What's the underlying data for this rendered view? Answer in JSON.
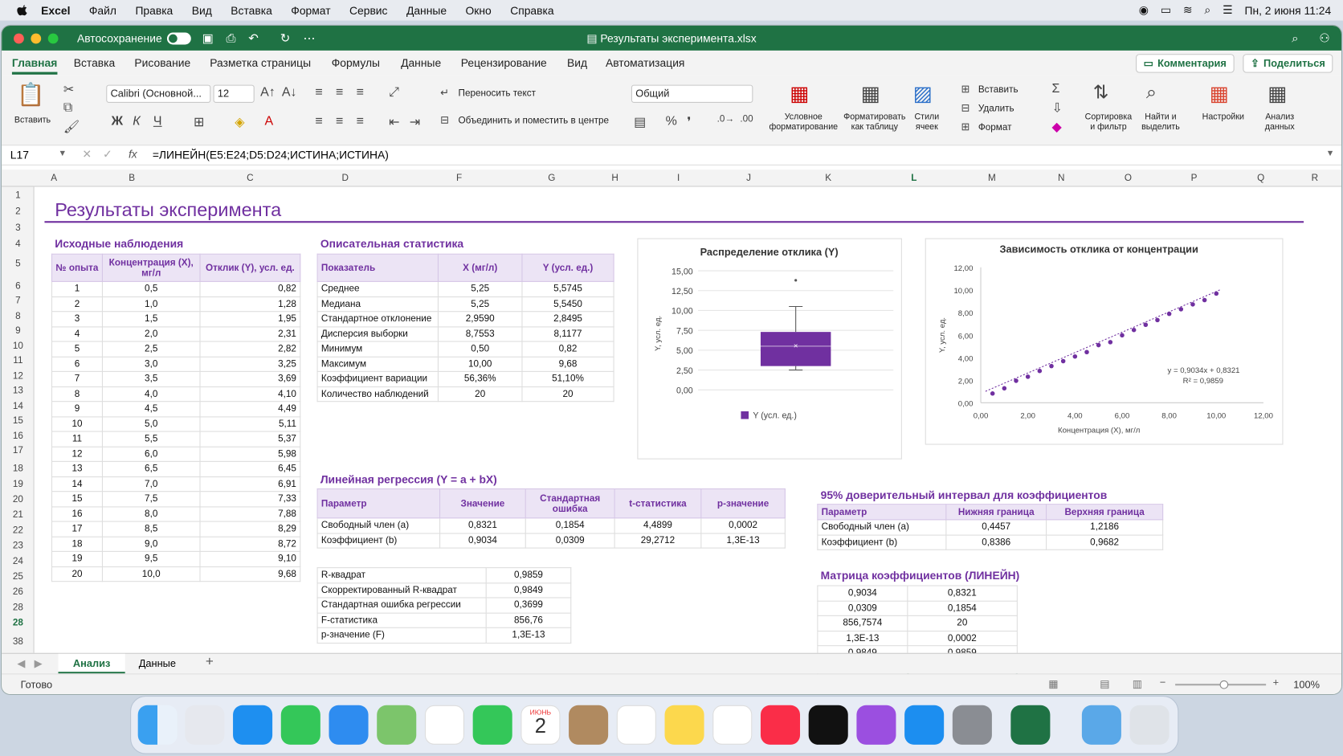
{
  "menubar": {
    "app": "Excel",
    "items": [
      "Файл",
      "Правка",
      "Вид",
      "Вставка",
      "Формат",
      "Сервис",
      "Данные",
      "Окно",
      "Справка"
    ],
    "clock": "Пн, 2 июня  11:24"
  },
  "titlebar": {
    "autosave": "Автосохранение",
    "filename": "Результаты эксперимента.xlsx"
  },
  "ribbon_tabs": [
    "Главная",
    "Вставка",
    "Рисование",
    "Разметка страницы",
    "Формулы",
    "Данные",
    "Рецензирование",
    "Вид",
    "Автоматизация"
  ],
  "comments_button": "Комментария",
  "share_button": "Поделиться",
  "ribbon": {
    "paste": "Вставить",
    "font": "Calibri (Основной...",
    "size": "12",
    "wrap": "Переносить текст",
    "merge": "Объединить и поместить в центре",
    "numfmt": "Общий",
    "cond1": "Условное",
    "cond2": "форматирование",
    "fmt1": "Форматировать",
    "fmt2": "как таблицу",
    "styles1": "Стили",
    "styles2": "ячеек",
    "insert": "Вставить",
    "delete": "Удалить",
    "format": "Формат",
    "sort1": "Сортировка",
    "sort2": "и фильтр",
    "find1": "Найти и",
    "find2": "выделить",
    "settings": "Настройки",
    "analysis1": "Анализ",
    "analysis2": "данных",
    "bold": "Ж",
    "italic": "К",
    "underline": "Ч"
  },
  "formula_bar": {
    "cell": "L17",
    "formula": "=ЛИНЕЙН(E5:E24;D5:D24;ИСТИНА;ИСТИНА)"
  },
  "columns": [
    [
      "A",
      61
    ],
    [
      "B",
      152
    ],
    [
      "C",
      290
    ],
    [
      "D",
      401
    ],
    [
      "F",
      534
    ],
    [
      "G",
      642
    ],
    [
      "H",
      716
    ],
    [
      "I",
      790
    ],
    [
      "J",
      872
    ],
    [
      "K",
      965
    ],
    [
      "L",
      1065
    ],
    [
      "M",
      1156
    ],
    [
      "N",
      1237
    ],
    [
      "O",
      1315
    ],
    [
      "P",
      1392
    ],
    [
      "Q",
      1470
    ],
    [
      "R",
      1533
    ]
  ],
  "rows": [
    "1",
    "2",
    "3",
    "4",
    "5",
    "6",
    "7",
    "8",
    "9",
    "10",
    "11",
    "12",
    "13",
    "14",
    "15",
    "16",
    "17",
    "18",
    "19",
    "20",
    "21",
    "22",
    "23",
    "24",
    "25",
    "26",
    "28",
    "28",
    "38"
  ],
  "sheet": {
    "title": "Результаты эксперимента",
    "obs": {
      "title": "Исходные наблюдения",
      "headers": [
        "№ опыта",
        "Концентрация (X), мг/л",
        "Отклик (Y), усл. ед."
      ],
      "rows": [
        [
          "1",
          "0,5",
          "0,82"
        ],
        [
          "2",
          "1,0",
          "1,28"
        ],
        [
          "3",
          "1,5",
          "1,95"
        ],
        [
          "4",
          "2,0",
          "2,31"
        ],
        [
          "5",
          "2,5",
          "2,82"
        ],
        [
          "6",
          "3,0",
          "3,25"
        ],
        [
          "7",
          "3,5",
          "3,69"
        ],
        [
          "8",
          "4,0",
          "4,10"
        ],
        [
          "9",
          "4,5",
          "4,49"
        ],
        [
          "10",
          "5,0",
          "5,11"
        ],
        [
          "11",
          "5,5",
          "5,37"
        ],
        [
          "12",
          "6,0",
          "5,98"
        ],
        [
          "13",
          "6,5",
          "6,45"
        ],
        [
          "14",
          "7,0",
          "6,91"
        ],
        [
          "15",
          "7,5",
          "7,33"
        ],
        [
          "16",
          "8,0",
          "7,88"
        ],
        [
          "17",
          "8,5",
          "8,29"
        ],
        [
          "18",
          "9,0",
          "8,72"
        ],
        [
          "19",
          "9,5",
          "9,10"
        ],
        [
          "20",
          "10,0",
          "9,68"
        ]
      ]
    },
    "desc": {
      "title": "Описательная статистика",
      "headers": [
        "Показатель",
        "X (мг/л)",
        "Y (усл. ед.)"
      ],
      "rows": [
        [
          "Среднее",
          "5,25",
          "5,5745"
        ],
        [
          "Медиана",
          "5,25",
          "5,5450"
        ],
        [
          "Стандартное отклонение",
          "2,9590",
          "2,8495"
        ],
        [
          "Дисперсия выборки",
          "8,7553",
          "8,1177"
        ],
        [
          "Минимум",
          "0,50",
          "0,82"
        ],
        [
          "Максимум",
          "10,00",
          "9,68"
        ],
        [
          "Коэффициент вариации",
          "56,36%",
          "51,10%"
        ],
        [
          "Количество наблюдений",
          "20",
          "20"
        ]
      ]
    },
    "reg": {
      "title": "Линейная регрессия (Y = a + bX)",
      "headers": [
        "Параметр",
        "Значение",
        "Стандартная ошибка",
        "t-статистика",
        "p-значение"
      ],
      "rows": [
        [
          "Свободный член (a)",
          "0,8321",
          "0,1854",
          "4,4899",
          "0,0002"
        ],
        [
          "Коэффициент (b)",
          "0,9034",
          "0,0309",
          "29,2712",
          "1,3E-13"
        ]
      ]
    },
    "fit": {
      "rows": [
        [
          "R-квадрат",
          "0,9859"
        ],
        [
          "Скорректированный R-квадрат",
          "0,9849"
        ],
        [
          "Стандартная ошибка регрессии",
          "0,3699"
        ],
        [
          "F-статистика",
          "856,76"
        ],
        [
          "p-значение (F)",
          "1,3E-13"
        ]
      ]
    },
    "ci": {
      "title": "95% доверительный интервал для коэффициентов",
      "headers": [
        "Параметр",
        "Нижняя граница",
        "Верхняя граница"
      ],
      "rows": [
        [
          "Свободный член (a)",
          "0,4457",
          "1,2186"
        ],
        [
          "Коэффициент (b)",
          "0,8386",
          "0,9682"
        ]
      ]
    },
    "matrix": {
      "title": "Матрица коэффициентов (ЛИНЕЙН)",
      "rows": [
        [
          "0,9034",
          "0,8321"
        ],
        [
          "0,0309",
          "0,1854"
        ],
        [
          "856,7574",
          "20"
        ],
        [
          "1,3E-13",
          "0,0002"
        ],
        [
          "0,9849",
          "0,9859"
        ],
        [
          "",
          ""
        ]
      ]
    }
  },
  "chart_data": [
    {
      "type": "box",
      "title": "Распределение отклика (Y)",
      "ylabel": "Y, усл. ед.",
      "legend": "Y (усл. ед.)",
      "yticks": [
        "0,00",
        "2,50",
        "5,00",
        "7,50",
        "10,00",
        "12,50",
        "15,00"
      ],
      "ylim": [
        0,
        15
      ],
      "min": 2.5,
      "q1": 3.0,
      "median": 5.5,
      "mean": 5.5745,
      "q3": 7.3,
      "max": 10.5,
      "outlier": 13.8,
      "color": "#7030a0"
    },
    {
      "type": "scatter",
      "title": "Зависимость отклика от концентрации",
      "xlabel": "Концентрация (X), мг/л",
      "ylabel": "Y, усл. ед.",
      "xticks": [
        "0,00",
        "2,00",
        "4,00",
        "6,00",
        "8,00",
        "10,00",
        "12,00"
      ],
      "yticks": [
        "0,00",
        "2,00",
        "4,00",
        "6,00",
        "8,00",
        "10,00",
        "12,00"
      ],
      "xlim": [
        0,
        12
      ],
      "ylim": [
        0,
        12
      ],
      "x": [
        0.5,
        1.0,
        1.5,
        2.0,
        2.5,
        3.0,
        3.5,
        4.0,
        4.5,
        5.0,
        5.5,
        6.0,
        6.5,
        7.0,
        7.5,
        8.0,
        8.5,
        9.0,
        9.5,
        10.0
      ],
      "y": [
        0.82,
        1.28,
        1.95,
        2.31,
        2.82,
        3.25,
        3.69,
        4.1,
        4.49,
        5.11,
        5.37,
        5.98,
        6.45,
        6.91,
        7.33,
        7.88,
        8.29,
        8.72,
        9.1,
        9.68
      ],
      "trend_label": "y = 0,9034x + 0,8321",
      "r2_label": "R² = 0,9859",
      "color": "#7030a0"
    }
  ],
  "sheet_tabs": [
    "Анализ",
    "Данные"
  ],
  "status": {
    "ready": "Готово",
    "zoom": "100%"
  },
  "dock": {
    "calendar_month": "ИЮНЬ",
    "calendar_day": "2"
  }
}
